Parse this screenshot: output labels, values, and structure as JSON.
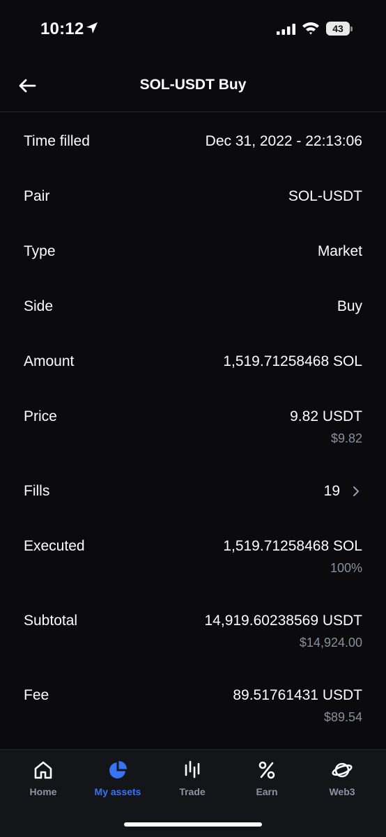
{
  "status_bar": {
    "time": "10:12",
    "battery": "43"
  },
  "header": {
    "title": "SOL-USDT Buy"
  },
  "details": {
    "time_filled": {
      "label": "Time filled",
      "value": "Dec 31, 2022 - 22:13:06"
    },
    "pair": {
      "label": "Pair",
      "value": "SOL-USDT"
    },
    "type": {
      "label": "Type",
      "value": "Market"
    },
    "side": {
      "label": "Side",
      "value": "Buy"
    },
    "amount": {
      "label": "Amount",
      "value": "1,519.71258468 SOL"
    },
    "price": {
      "label": "Price",
      "value": "9.82 USDT",
      "sub": "$9.82"
    },
    "fills": {
      "label": "Fills",
      "value": "19"
    },
    "executed": {
      "label": "Executed",
      "value": "1,519.71258468 SOL",
      "sub": "100%"
    },
    "subtotal": {
      "label": "Subtotal",
      "value": "14,919.60238569 USDT",
      "sub": "$14,924.00"
    },
    "fee": {
      "label": "Fee",
      "value": "89.51761431 USDT",
      "sub": "$89.54"
    }
  },
  "nav": {
    "active": "my_assets",
    "home": "Home",
    "my_assets": "My assets",
    "trade": "Trade",
    "earn": "Earn",
    "web3": "Web3"
  },
  "colors": {
    "background": "#0b0b0d",
    "accent": "#3773f5",
    "muted_text": "#8a8f9c",
    "nav_background": "#141519"
  },
  "icons": {
    "back": "arrow-left-icon",
    "fills_more": "chevron-right-icon",
    "home": "home-icon",
    "my_assets": "pie-chart-icon",
    "trade": "candlestick-icon",
    "earn": "percent-icon",
    "web3": "planet-icon"
  }
}
